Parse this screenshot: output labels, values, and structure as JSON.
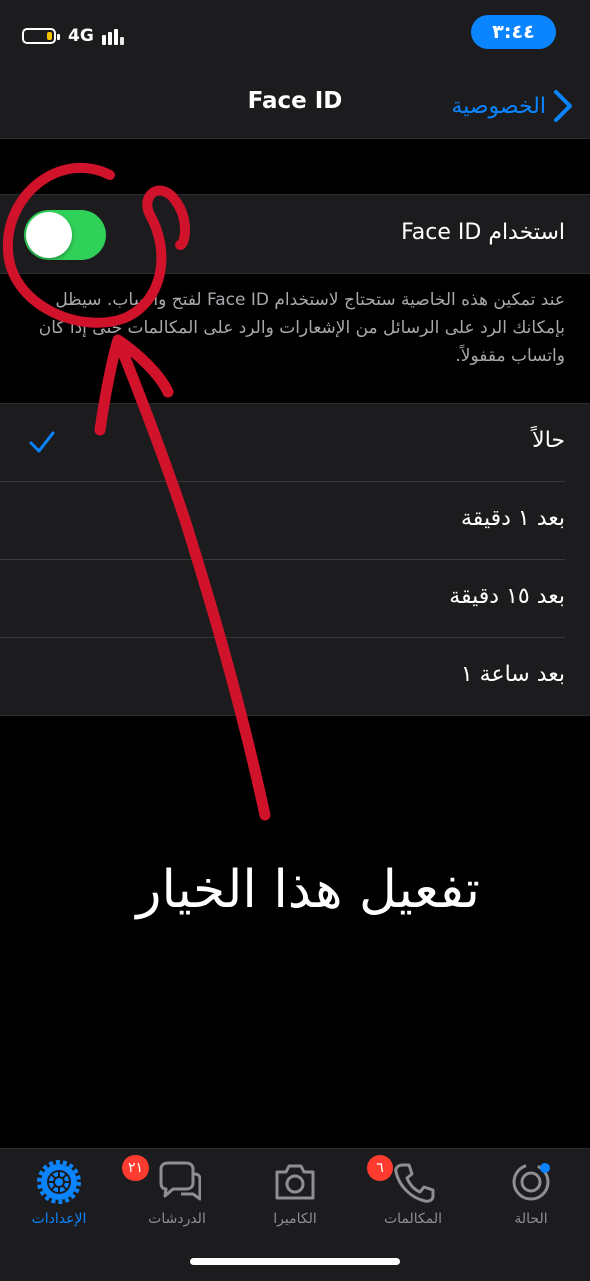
{
  "status_bar": {
    "network": "4G",
    "time": "٣:٤٤",
    "battery_level": 0.2,
    "battery_color": "#f5c400"
  },
  "nav": {
    "title": "Face ID",
    "back_label": "الخصوصية",
    "back_icon": "chevron-right-icon"
  },
  "face_id": {
    "label": "استخدام Face ID",
    "enabled": true,
    "footnote": "عند تمكين هذه الخاصية ستحتاج لاستخدام Face ID لفتح واتساب. سيظل بإمكانك الرد على الرسائل من الإشعارات والرد على المكالمات حتى إذا كان واتساب مقفولاً."
  },
  "lock_options": {
    "items": [
      {
        "label": "حالاً",
        "selected": true
      },
      {
        "label": "بعد ١ دقيقة",
        "selected": false
      },
      {
        "label": "بعد ١٥ دقيقة",
        "selected": false
      },
      {
        "label": "بعد ساعة ١",
        "selected": false
      }
    ]
  },
  "annotation": {
    "text": "تفعيل هذا الخيار",
    "color": "#d0122b"
  },
  "tab_bar": {
    "tabs": [
      {
        "label": "الحالة",
        "icon": "status-icon"
      },
      {
        "label": "المكالمات",
        "icon": "phone-icon",
        "badge": "٦"
      },
      {
        "label": "الكاميرا",
        "icon": "camera-icon"
      },
      {
        "label": "الدردشات",
        "icon": "chats-icon",
        "badge": "٢١"
      },
      {
        "label": "الإعدادات",
        "icon": "settings-icon",
        "active": true
      }
    ],
    "active_color": "#0a84ff",
    "inactive_color": "#8e8e93"
  },
  "colors": {
    "accent": "#0a84ff",
    "toggle_on": "#30d158",
    "badge": "#ff3b30"
  }
}
